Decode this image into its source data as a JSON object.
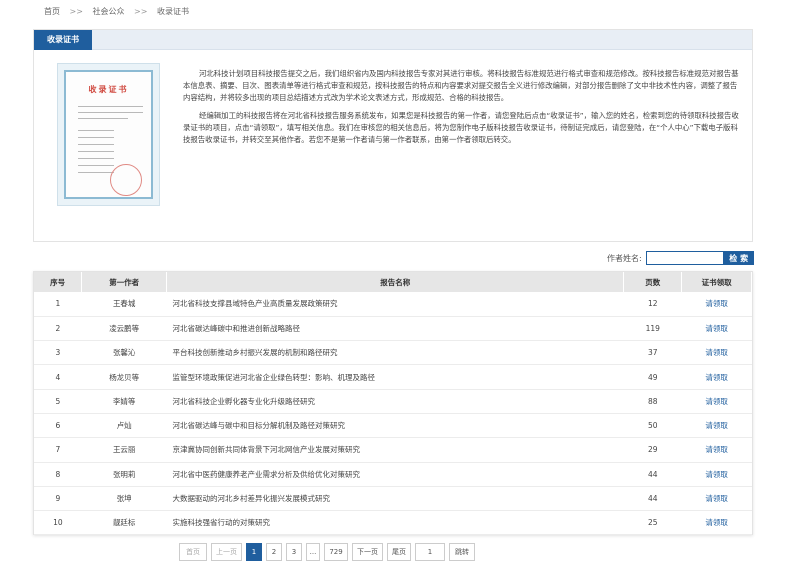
{
  "breadcrumb": {
    "home": "首页",
    "sep1": ">>",
    "level1": "社会公众",
    "sep2": ">>",
    "current": "收录证书"
  },
  "panel": {
    "tab": "收录证书",
    "cert_title": "收录证书",
    "paragraphs": [
      "河北科技计划项目科技报告提交之后，我们组织省内及国内科技报告专家对其进行审核。将科技报告标准规范进行格式审查和规范修改。按科技报告标准规范对报告基本信息表、摘要、目次、图表清单等进行格式审查和规范，按科技报告的特点和内容要求对提交报告全义进行修改编辑，对部分报告删除了文中非技术性内容，调整了报告内容结构，并将较多出现的项目总结描述方式改为学术论文表述方式，形成规范、合格的科技报告。",
      "经编辑加工的科技报告将在河北省科技报告服务系统发布，如果您是科技报告的第一作者，请您登陆后点击“收录证书”，输入您的姓名，检索到您的待领取科技报告收录证书的项目，点击“请领取”，填写相关信息。我们在审核您的相关信息后，将为您制作电子版科技报告收录证书，待制证完成后，请您登陆，在“个人中心”下载电子版科技报告收录证书，并转交至其他作者。若您不是第一作者请与第一作者联系，由第一作者领取后转交。"
    ]
  },
  "search": {
    "label": "作者姓名:",
    "value": "",
    "placeholder": "",
    "button": "检 索"
  },
  "table": {
    "headers": {
      "no": "序号",
      "author": "第一作者",
      "title": "报告名称",
      "pages": "页数",
      "action": "证书领取"
    },
    "rows": [
      {
        "no": "1",
        "author": "王春城",
        "title": "河北省科技支撑县域特色产业高质量发展政策研究",
        "pages": "12",
        "action": "请领取"
      },
      {
        "no": "2",
        "author": "凌云鹏等",
        "title": "河北省碳达峰碳中和推进创新战略路径",
        "pages": "119",
        "action": "请领取"
      },
      {
        "no": "3",
        "author": "张馨沁",
        "title": "平台科技创新推动乡村振兴发展的机制和路径研究",
        "pages": "37",
        "action": "请领取"
      },
      {
        "no": "4",
        "author": "杨龙贝等",
        "title": "监管型环境政策促进河北省企业绿色转型：影响、机理及路径",
        "pages": "49",
        "action": "请领取"
      },
      {
        "no": "5",
        "author": "李婧等",
        "title": "河北省科技企业孵化器专业化升级路径研究",
        "pages": "88",
        "action": "请领取"
      },
      {
        "no": "6",
        "author": "卢灿",
        "title": "河北省碳达峰与碳中和目标分解机制及路径对策研究",
        "pages": "50",
        "action": "请领取"
      },
      {
        "no": "7",
        "author": "王云丽",
        "title": "京津冀协同创新共同体背景下河北网信产业发展对策研究",
        "pages": "29",
        "action": "请领取"
      },
      {
        "no": "8",
        "author": "张明莉",
        "title": "河北省中医药健康养老产业需求分析及供给优化对策研究",
        "pages": "44",
        "action": "请领取"
      },
      {
        "no": "9",
        "author": "张坤",
        "title": "大数据驱动的河北乡村差异化振兴发展模式研究",
        "pages": "44",
        "action": "请领取"
      },
      {
        "no": "10",
        "author": "靓廷标",
        "title": "实施科技强省行动的对策研究",
        "pages": "25",
        "action": "请领取"
      }
    ]
  },
  "pager": {
    "first": "首页",
    "prev": "上一页",
    "p1": "1",
    "p2": "2",
    "p3": "3",
    "ellipsis": "...",
    "last_num": "729",
    "next": "下一页",
    "end": "尾页",
    "goto_value": "1",
    "jump": "跳转"
  },
  "colors": {
    "accent": "#1f5e9e",
    "header_bg": "#e6e6e6",
    "panel_head_bg": "#e8eef5"
  }
}
